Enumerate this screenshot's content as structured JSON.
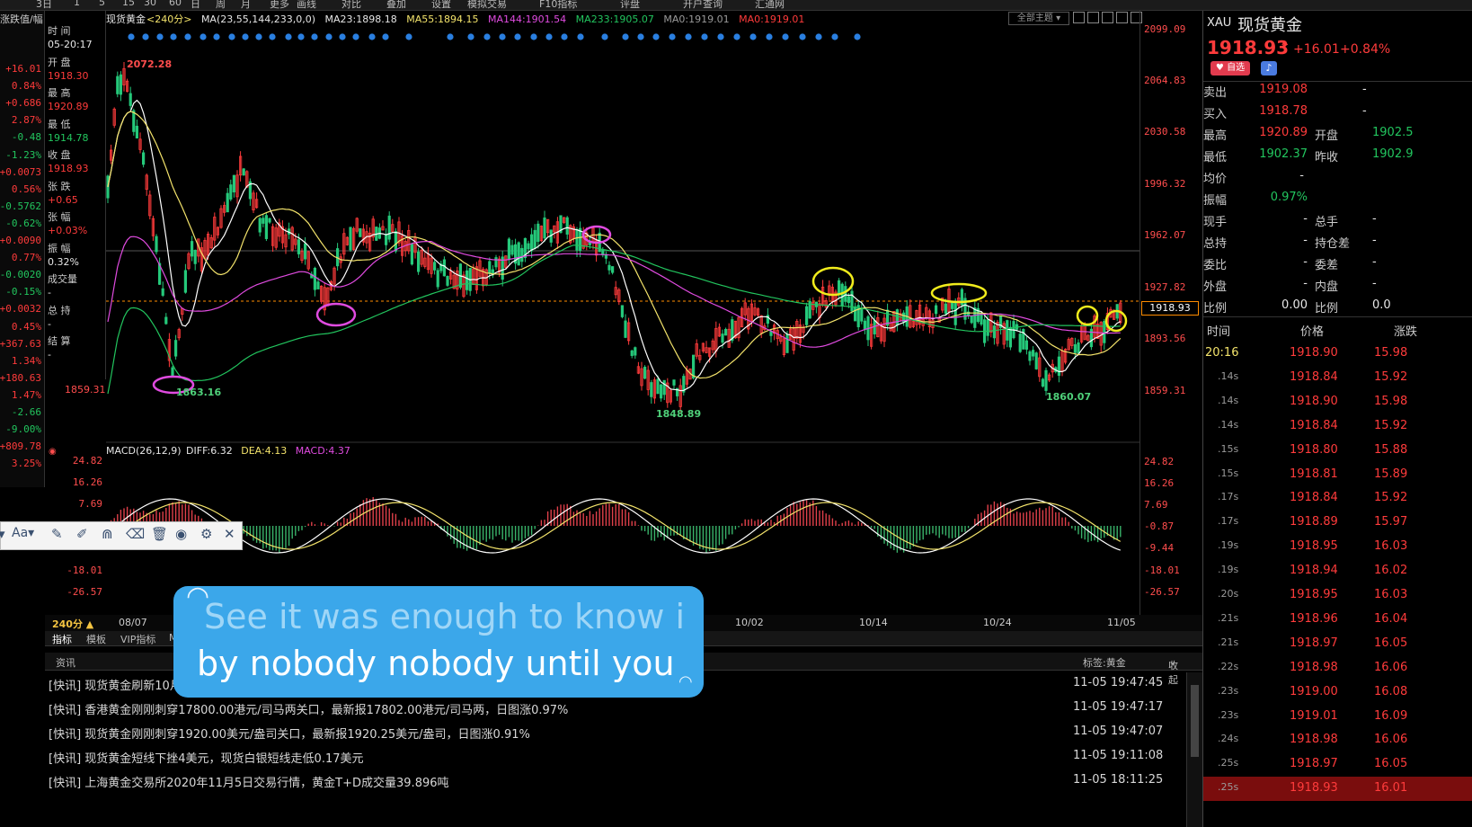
{
  "menu": [
    "3日",
    "1",
    "5",
    "15",
    "30",
    "60",
    "日",
    "周",
    "月",
    "更多",
    "画线",
    "对比",
    "叠加",
    "设置",
    "模拟交易",
    "F10指标",
    "评盘",
    "开户查询",
    "汇通网"
  ],
  "instrument": {
    "name": "现货黄金",
    "period_tag": "<240分>",
    "code": "XAU",
    "title": "现货黄金",
    "price": "1918.93",
    "change": "+16.01",
    "change_pct": "+0.84%",
    "favorite_label": "自选",
    "bell_icon": "bell-icon"
  },
  "ma_legend": {
    "ma": "MA(23,55,144,233,0,0)",
    "ma23": "MA23:1898.18",
    "ma55": "MA55:1894.15",
    "ma144": "MA144:1901.54",
    "ma233": "MA233:1905.07",
    "ma0a": "MA0:1919.01",
    "ma0b": "MA0:1919.01"
  },
  "theme_button": "全部主题",
  "left_header": "涨跌值/幅",
  "left_values": [
    {
      "v": "+16.01",
      "c": "red"
    },
    {
      "v": "0.84%",
      "c": "red"
    },
    {
      "v": "+0.686",
      "c": "red"
    },
    {
      "v": "2.87%",
      "c": "red"
    },
    {
      "v": "-0.48",
      "c": "green"
    },
    {
      "v": "-1.23%",
      "c": "green"
    },
    {
      "v": "+0.0073",
      "c": "red"
    },
    {
      "v": "0.56%",
      "c": "red"
    },
    {
      "v": "-0.5762",
      "c": "green"
    },
    {
      "v": "-0.62%",
      "c": "green"
    },
    {
      "v": "+0.0090",
      "c": "red"
    },
    {
      "v": "0.77%",
      "c": "red"
    },
    {
      "v": "-0.0020",
      "c": "green"
    },
    {
      "v": "-0.15%",
      "c": "green"
    },
    {
      "v": "+0.0032",
      "c": "red"
    },
    {
      "v": "0.45%",
      "c": "red"
    },
    {
      "v": "+367.63",
      "c": "red"
    },
    {
      "v": "1.34%",
      "c": "red"
    },
    {
      "v": "+180.63",
      "c": "red"
    },
    {
      "v": "1.47%",
      "c": "red"
    },
    {
      "v": "-2.66",
      "c": "green"
    },
    {
      "v": "-9.00%",
      "c": "green"
    },
    {
      "v": "+809.78",
      "c": "red"
    },
    {
      "v": "3.25%",
      "c": "red"
    }
  ],
  "info": [
    {
      "label": "时 间",
      "value": "05-20:17",
      "c": "white"
    },
    {
      "label": "开 盘",
      "value": "1918.30",
      "c": "red"
    },
    {
      "label": "最 高",
      "value": "1920.89",
      "c": "red"
    },
    {
      "label": "最 低",
      "value": "1914.78",
      "c": "green"
    },
    {
      "label": "收 盘",
      "value": "1918.93",
      "c": "red"
    },
    {
      "label": "张 跌",
      "value": "+0.65",
      "c": "red"
    },
    {
      "label": "张 幅",
      "value": "+0.03%",
      "c": "red"
    },
    {
      "label": "振 幅",
      "value": "0.32%",
      "c": "white"
    },
    {
      "label": "成交量",
      "value": "-",
      "c": "white"
    },
    {
      "label": "总 持",
      "value": "-",
      "c": "white"
    },
    {
      "label": "结 算",
      "value": "-",
      "c": "white"
    }
  ],
  "price_axis": [
    "2099.09",
    "2064.83",
    "2030.58",
    "1996.32",
    "1962.07",
    "1927.82",
    "1893.56",
    "1859.31"
  ],
  "left_axis_label": "1859.31",
  "current_price_box": "1918.93",
  "price_annotations": [
    "2072.28",
    "1863.16",
    "1848.89",
    "1860.07"
  ],
  "macd": {
    "title": "MACD(26,12,9)",
    "diff": "DIFF:6.32",
    "dea": "DEA:4.13",
    "macd": "MACD:4.37",
    "axis": [
      "24.82",
      "16.26",
      "7.69",
      "-0.87",
      "-9.44",
      "-18.01",
      "-26.57"
    ],
    "left_axis": [
      "24.82",
      "16.26",
      "7.69",
      "-18.01",
      "-26.57"
    ]
  },
  "period_label": "240分 ▲",
  "dates": [
    "08/07",
    "10/02",
    "10/14",
    "10/24",
    "11/05"
  ],
  "tabs": [
    "指标",
    "模板",
    "VIP指标",
    "M"
  ],
  "news_header": {
    "title": "资讯",
    "tag": "标签:黄金",
    "collapse": "收起"
  },
  "news": [
    {
      "text": "[快讯] 现货黄金刷新10月",
      "time": "11-05 19:47:45"
    },
    {
      "text": "[快讯] 香港黄金刚刚刺穿17800.00港元/司马两关口，最新报17802.00港元/司马两，日图涨0.97%",
      "time": "11-05 19:47:17"
    },
    {
      "text": "[快讯] 现货黄金刚刚刺穿1920.00美元/盎司关口，最新报1920.25美元/盎司，日图涨0.91%",
      "time": "11-05 19:47:07"
    },
    {
      "text": "[快讯] 现货黄金短线下挫4美元，现货白银短线走低0.17美元",
      "time": "11-05 19:11:08"
    },
    {
      "text": "[快讯] 上海黄金交易所2020年11月5日交易行情，黄金T+D成交量39.896吨",
      "time": "11-05 18:11:25"
    }
  ],
  "quote": {
    "sell": {
      "label": "卖出",
      "value": "1919.08",
      "extra": "-"
    },
    "buy": {
      "label": "买入",
      "value": "1918.78",
      "extra": "-"
    },
    "high": {
      "label": "最高",
      "value": "1920.89",
      "label2": "开盘",
      "value2": "1902.5"
    },
    "low": {
      "label": "最低",
      "value": "1902.37",
      "label2": "昨收",
      "value2": "1902.9"
    },
    "avg": {
      "label": "均价",
      "value": "-"
    },
    "amp": {
      "label": "振幅",
      "value": "0.97%"
    },
    "row1": {
      "label": "现手",
      "value": "-",
      "label2": "总手",
      "value2": "-"
    },
    "row2": {
      "label": "总持",
      "value": "-",
      "label2": "持仓差",
      "value2": "-"
    },
    "row3": {
      "label": "委比",
      "value": "-",
      "label2": "委差",
      "value2": "-"
    },
    "row4": {
      "label": "外盘",
      "value": "-",
      "label2": "内盘",
      "value2": "-"
    },
    "row5": {
      "label": "比例",
      "value": "0.00",
      "label2": "比例",
      "value2": "0.0"
    }
  },
  "tick_header": {
    "time": "时间",
    "price": "价格",
    "change": "涨跌"
  },
  "ticks": [
    {
      "t": "20:16",
      "p": "1918.90",
      "c": "15.98"
    },
    {
      "t": ".14s",
      "p": "1918.84",
      "c": "15.92"
    },
    {
      "t": ".14s",
      "p": "1918.90",
      "c": "15.98"
    },
    {
      "t": ".14s",
      "p": "1918.84",
      "c": "15.92"
    },
    {
      "t": ".15s",
      "p": "1918.80",
      "c": "15.88"
    },
    {
      "t": ".15s",
      "p": "1918.81",
      "c": "15.89"
    },
    {
      "t": ".17s",
      "p": "1918.84",
      "c": "15.92"
    },
    {
      "t": ".17s",
      "p": "1918.89",
      "c": "15.97"
    },
    {
      "t": ".19s",
      "p": "1918.95",
      "c": "16.03"
    },
    {
      "t": ".19s",
      "p": "1918.94",
      "c": "16.02"
    },
    {
      "t": ".20s",
      "p": "1918.95",
      "c": "16.03"
    },
    {
      "t": ".21s",
      "p": "1918.96",
      "c": "16.04"
    },
    {
      "t": ".21s",
      "p": "1918.97",
      "c": "16.05"
    },
    {
      "t": ".22s",
      "p": "1918.98",
      "c": "16.06"
    },
    {
      "t": ".23s",
      "p": "1919.00",
      "c": "16.08"
    },
    {
      "t": ".23s",
      "p": "1919.01",
      "c": "16.09"
    },
    {
      "t": ".24s",
      "p": "1918.98",
      "c": "16.06"
    },
    {
      "t": ".25s",
      "p": "1918.97",
      "c": "16.05"
    },
    {
      "t": ".25s",
      "p": "1918.93",
      "c": "16.01"
    }
  ],
  "subtitle": {
    "line1": "See it was enough to know i",
    "line2": "by nobody nobody until you"
  },
  "colors": {
    "up": "#ff3b3b",
    "down": "#22c55e",
    "ma23": "#ffffff",
    "ma55": "#f3e36b",
    "ma144": "#e04be0",
    "ma233": "#22c55e",
    "subtitle_bg": "#3ba7ea"
  }
}
